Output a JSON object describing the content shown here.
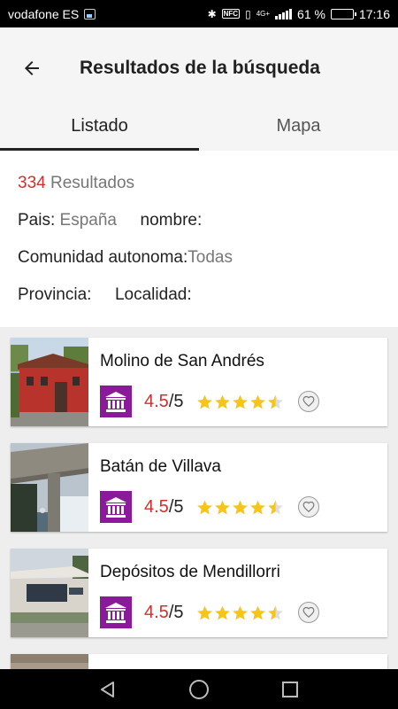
{
  "status_bar": {
    "carrier": "vodafone ES",
    "network": "4G+",
    "battery_percent": "61 %",
    "battery_level": 0.61,
    "time": "17:16",
    "icons": [
      "image-icon",
      "bluetooth-icon",
      "nfc-icon",
      "vibrate-icon",
      "signal-icon",
      "battery-icon"
    ]
  },
  "appbar": {
    "back_icon": "arrow-left-icon",
    "title": "Resultados de la búsqueda"
  },
  "tabs": [
    {
      "label": "Listado",
      "active": true
    },
    {
      "label": "Mapa",
      "active": false
    }
  ],
  "summary": {
    "count": "334",
    "count_label": "Resultados",
    "pais_label": "Pais:",
    "pais_value": "España",
    "nombre_label": "nombre:",
    "nombre_value": "",
    "comunidad_label": "Comunidad autonoma:",
    "comunidad_value": "Todas",
    "provincia_label": "Provincia:",
    "provincia_value": "",
    "localidad_label": "Localidad:",
    "localidad_value": ""
  },
  "results": [
    {
      "name": "Molino de San Andrés",
      "rating": "4.5",
      "rating_max": "/5",
      "stars": 4.5,
      "category_icon": "museum-icon",
      "favorite_icon": "heart-outline-icon"
    },
    {
      "name": "Batán de Villava",
      "rating": "4.5",
      "rating_max": "/5",
      "stars": 4.5,
      "category_icon": "museum-icon",
      "favorite_icon": "heart-outline-icon"
    },
    {
      "name": "Depósitos de Mendillorri",
      "rating": "4.5",
      "rating_max": "/5",
      "stars": 4.5,
      "category_icon": "museum-icon",
      "favorite_icon": "heart-outline-icon"
    }
  ],
  "colors": {
    "accent_red": "#d32f2f",
    "museum_purple": "#8a1a9a",
    "star_yellow": "#f5c518"
  },
  "navbar": {
    "icons": [
      "back-triangle-icon",
      "home-circle-icon",
      "recents-square-icon"
    ]
  }
}
